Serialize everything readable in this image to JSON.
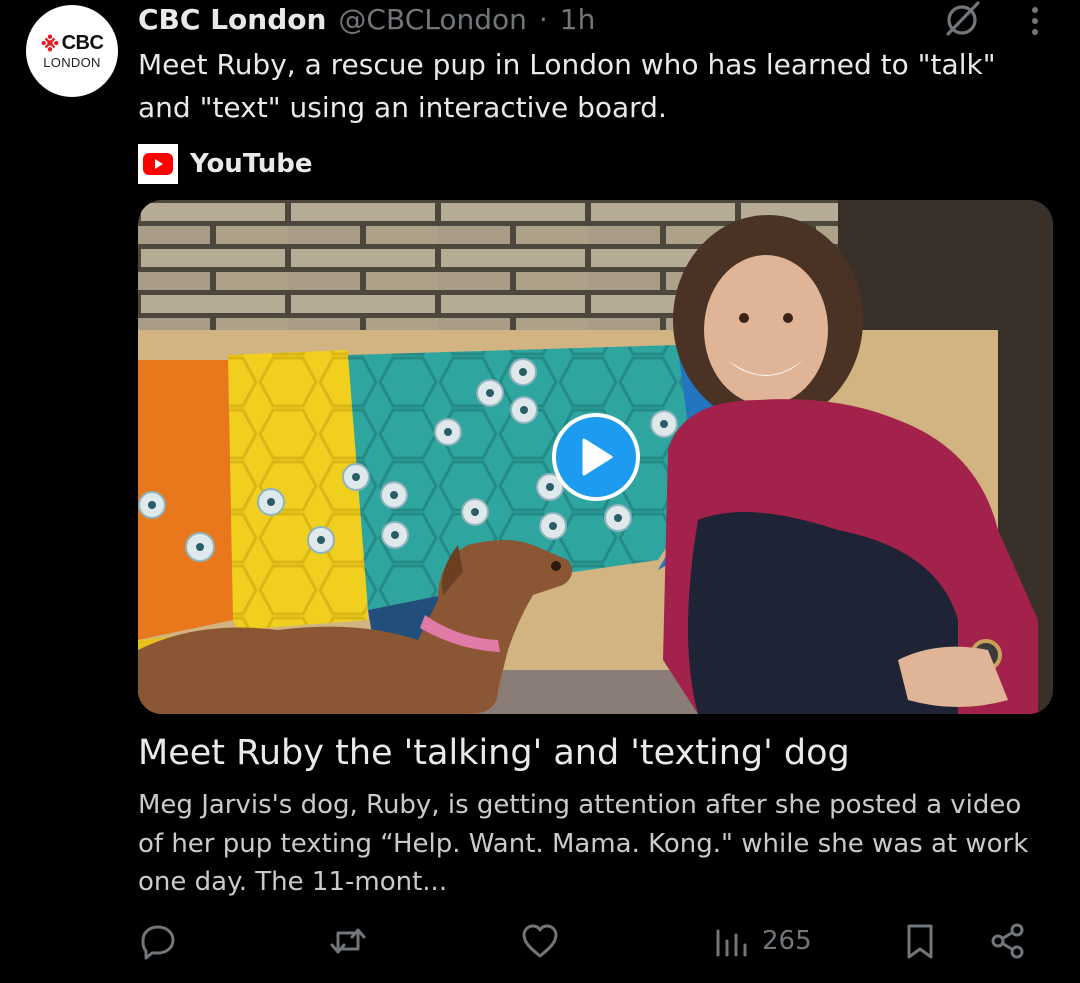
{
  "account": {
    "name": "CBC London",
    "handle": "@CBCLondon",
    "separator": "·",
    "time": "1h",
    "avatar_brand": "CBC",
    "avatar_city": "LONDON"
  },
  "tweet": {
    "text": "Meet Ruby, a rescue pup in London who has learned to \"talk\" and \"text\" using an interactive board."
  },
  "card": {
    "source": "YouTube",
    "title": "Meet Ruby the 'talking' and 'texting' dog",
    "description": "Meg Jarvis's dog, Ruby, is getting attention after she posted a video of her pup texting “Help. Want. Mama. Kong.\" while she was at work one day. The 11-mont..."
  },
  "actions": {
    "views": "265"
  },
  "icons": {
    "header": [
      "grok-icon",
      "more-icon"
    ],
    "bar": [
      "reply-icon",
      "retweet-icon",
      "like-icon",
      "views-icon",
      "bookmark-icon",
      "share-icon"
    ]
  },
  "colors": {
    "background": "#000000",
    "text": "#e7e9ea",
    "muted": "#71767b",
    "accent": "#1d9bf0",
    "youtube_red": "#ff0000",
    "cbc_red": "#e31b23"
  }
}
